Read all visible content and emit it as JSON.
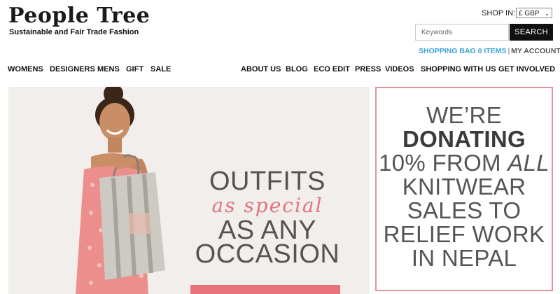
{
  "brand": {
    "logo": "People Tree",
    "tagline": "Sustainable and Fair Trade Fashion"
  },
  "header": {
    "shop_in_label": "SHOP IN:",
    "currency": "£ GBP",
    "search_placeholder": "Keywords",
    "search_button": "SEARCH",
    "shopping_bag": "SHOPPING BAG 0 ITEMS",
    "separator": "|",
    "my_account": "MY ACCOUNT"
  },
  "nav_left": [
    "WOMENS",
    "DESIGNERS",
    "MENS",
    "GIFT",
    "SALE"
  ],
  "nav_right": [
    "ABOUT US",
    "BLOG",
    "ECO EDIT",
    "PRESS",
    "VIDEOS",
    "SHOPPING WITH US",
    "GET INVOLVED"
  ],
  "hero": {
    "line1": "OUTFITS",
    "line2": "as special",
    "line3": "AS ANY",
    "line4": "OCCASION"
  },
  "donation": {
    "line1": "WE’RE",
    "line2": "DONATING",
    "line3a": "10% FROM ",
    "line3b": "ALL",
    "line4": "KNITWEAR",
    "line5": "SALES TO",
    "line6": "RELIEF WORK",
    "line7": "IN NEPAL"
  },
  "colors": {
    "accent_blue": "#3aa3d8",
    "accent_pink": "#e8717c",
    "border_pink": "#e8919c"
  }
}
